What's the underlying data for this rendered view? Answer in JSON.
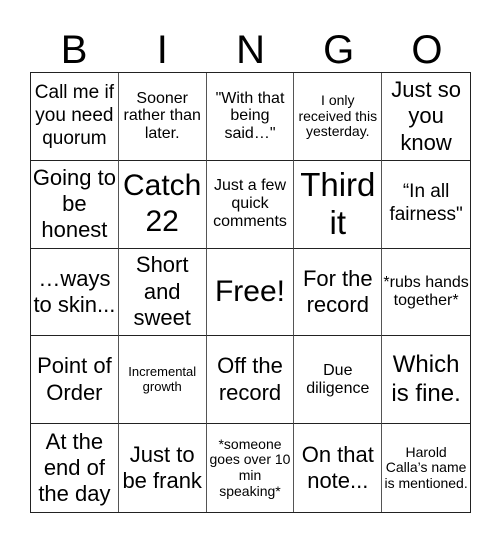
{
  "header": {
    "letters": [
      "B",
      "I",
      "N",
      "G",
      "O"
    ]
  },
  "board": {
    "rows": [
      [
        "Call me if you need quorum",
        "Sooner rather than later.",
        "\"With that being said…\"",
        "I only received this yesterday.",
        "Just so you know"
      ],
      [
        "Going to be honest",
        "Catch 22",
        "Just a few quick comments",
        "Third it",
        "“In all fairness\""
      ],
      [
        "…ways to skin...",
        "Short and sweet",
        "Free!",
        "For the record",
        "*rubs hands together*"
      ],
      [
        "Point of Order",
        "Incremental growth",
        "Off the record",
        "Due diligence",
        "Which is fine."
      ],
      [
        "At the end of the day",
        "Just to be frank",
        "*someone goes over 10 min speaking*",
        "On that note...",
        "Harold Calla’s name is mentioned."
      ]
    ],
    "free_space": "Free!"
  }
}
